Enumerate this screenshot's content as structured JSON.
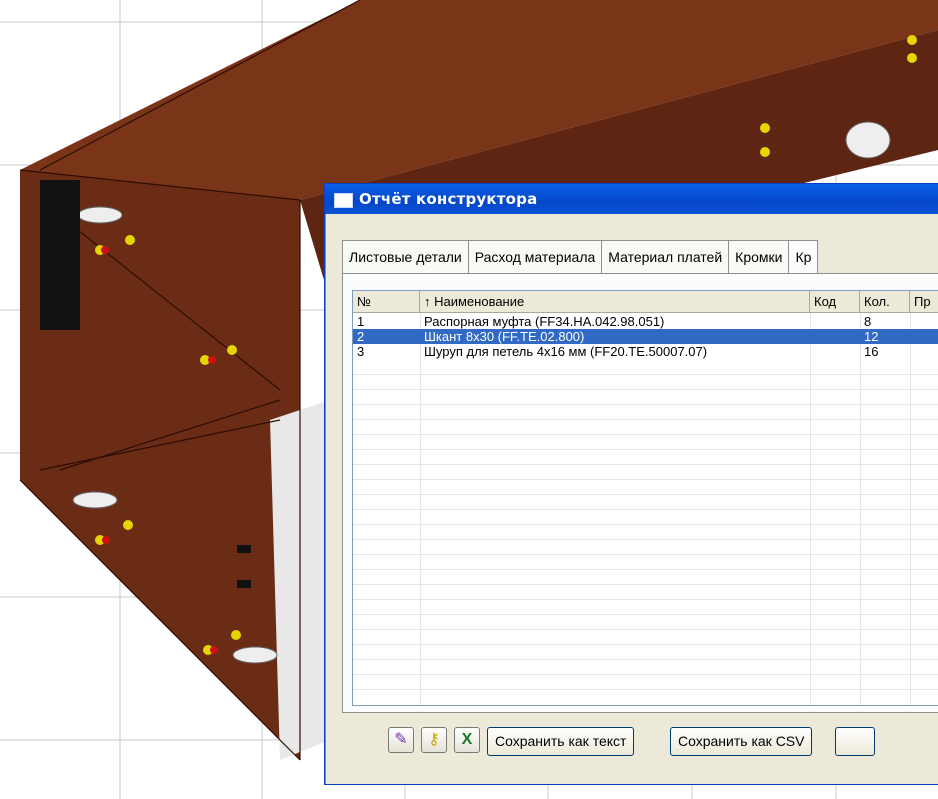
{
  "dialog": {
    "title": "Отчёт конструктора",
    "tabs": [
      "Листовые детали",
      "Расход материала",
      "Материал платей",
      "Кромки",
      "Кр"
    ],
    "columns": [
      "№",
      "↑  Наименование",
      "Код",
      "Кол.",
      "Пр"
    ],
    "rows": [
      {
        "num": "1",
        "name": "Распорная муфта (FF34.HA.042.98.051)",
        "code": "",
        "qty": "8"
      },
      {
        "num": "2",
        "name": "Шкант 8x30 (FF.TE.02.800)",
        "code": "",
        "qty": "12"
      },
      {
        "num": "3",
        "name": "Шуруп для петель 4x16 мм (FF20.TE.50007.07)",
        "code": "",
        "qty": "16"
      }
    ],
    "selected_row": 2,
    "buttons": {
      "save_text": "Сохранить как текст",
      "save_csv": "Сохранить как CSV"
    },
    "icons": [
      "edit-icon",
      "key-icon",
      "excel-icon"
    ]
  },
  "colors": {
    "titlebar": "#0a52d6",
    "selection": "#316ac5",
    "wood": "#6b2c16"
  }
}
